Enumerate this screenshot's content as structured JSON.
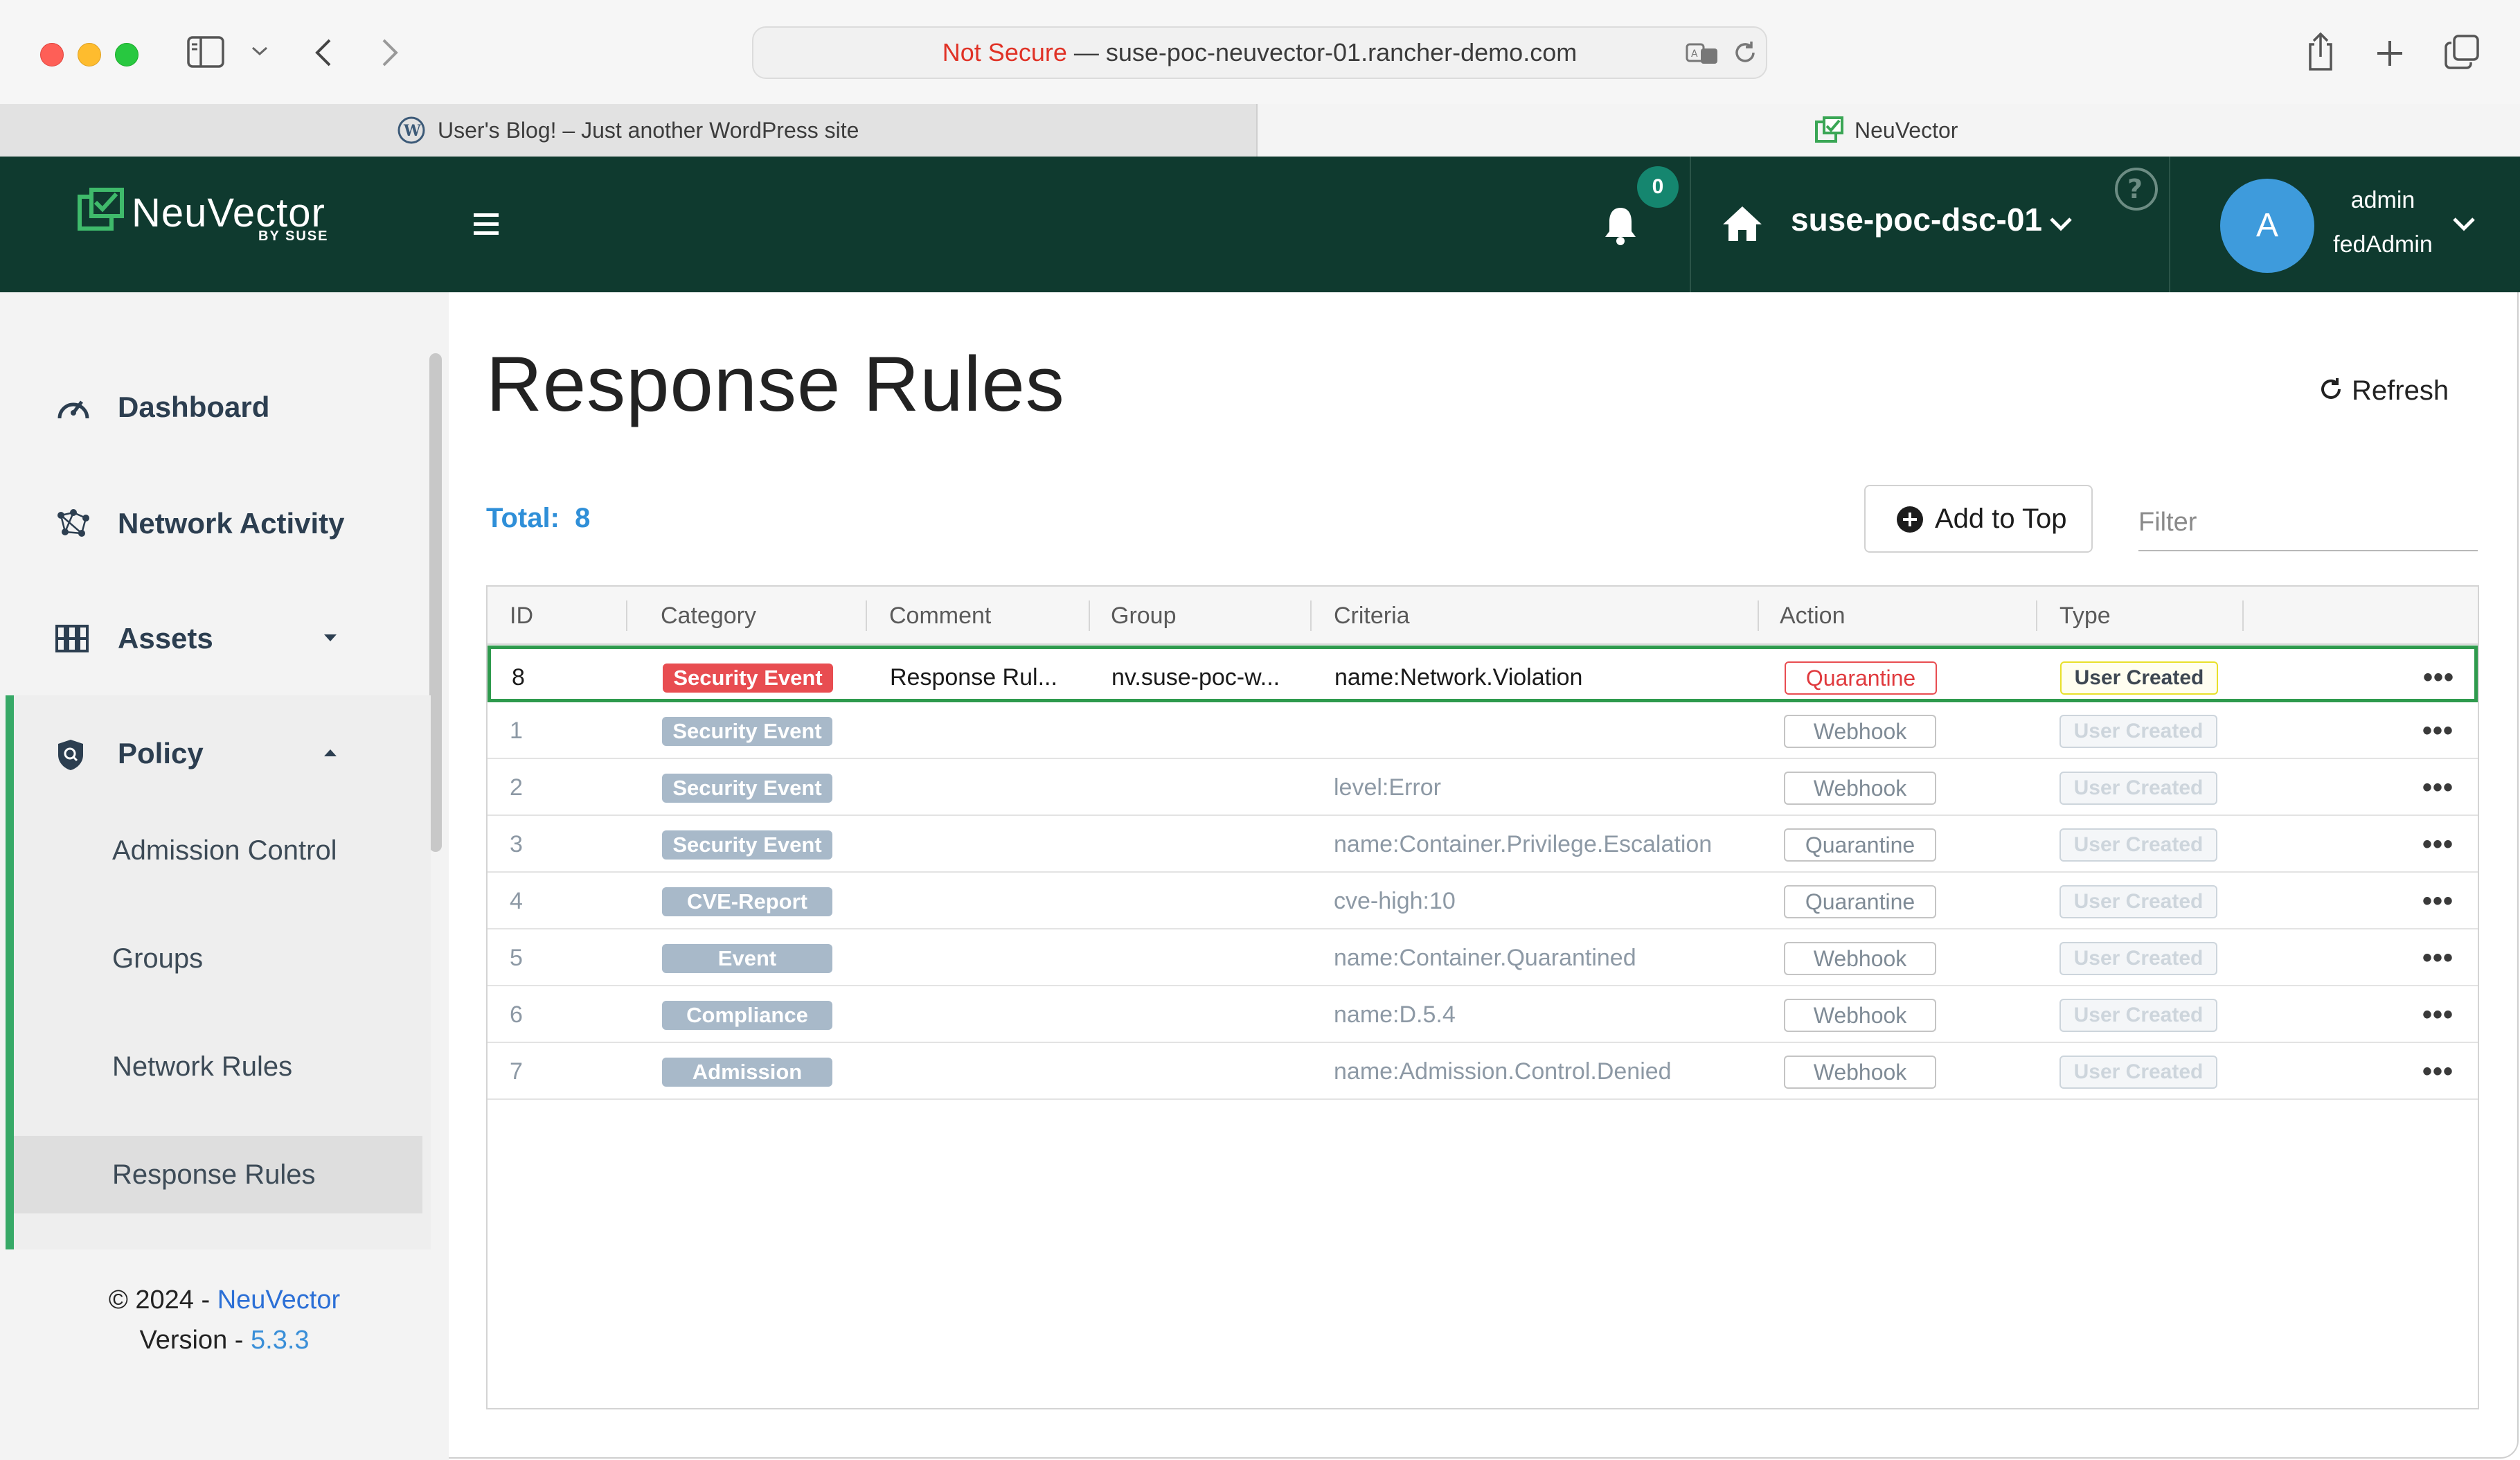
{
  "browser": {
    "url_insecure": "Not Secure",
    "url_sep": " — ",
    "url_host": "suse-poc-neuvector-01.rancher-demo.com",
    "tabs": [
      {
        "label": "User's Blog! – Just another WordPress site"
      },
      {
        "label": "NeuVector"
      }
    ]
  },
  "header": {
    "logo": "NeuVector",
    "logo_sub": "BY SUSE",
    "notifications": "0",
    "cluster": "suse-poc-dsc-01",
    "avatar_initial": "A",
    "user": "admin",
    "role": "fedAdmin"
  },
  "sidebar": {
    "items": [
      {
        "label": "Dashboard",
        "icon": "speedometer-icon"
      },
      {
        "label": "Network Activity",
        "icon": "network-icon"
      },
      {
        "label": "Assets",
        "icon": "assets-icon"
      },
      {
        "label": "Policy",
        "icon": "shield-icon"
      }
    ],
    "policy_sub": [
      {
        "label": "Admission Control"
      },
      {
        "label": "Groups"
      },
      {
        "label": "Network Rules"
      },
      {
        "label": "Response Rules"
      }
    ],
    "footer_copy": "© 2024 - ",
    "footer_brand": "NeuVector",
    "footer_version_label": "Version - ",
    "footer_version": "5.3.3"
  },
  "main": {
    "title": "Response Rules",
    "refresh": "Refresh",
    "total_label": "Total:",
    "total_value": "8",
    "add_to_top": "Add to Top",
    "filter_placeholder": "Filter",
    "columns": [
      "ID",
      "Category",
      "Comment",
      "Group",
      "Criteria",
      "Action",
      "Type"
    ],
    "rows": [
      {
        "id": "8",
        "category": "Security Event",
        "comment": "Response Rul...",
        "group": "nv.suse-poc-w...",
        "criteria": "name:Network.Violation",
        "action": "Quarantine",
        "type": "User Created"
      },
      {
        "id": "1",
        "category": "Security Event",
        "comment": "",
        "group": "",
        "criteria": "",
        "action": "Webhook",
        "type": "User Created"
      },
      {
        "id": "2",
        "category": "Security Event",
        "comment": "",
        "group": "",
        "criteria": "level:Error",
        "action": "Webhook",
        "type": "User Created"
      },
      {
        "id": "3",
        "category": "Security Event",
        "comment": "",
        "group": "",
        "criteria": "name:Container.Privilege.Escalation",
        "action": "Quarantine",
        "type": "User Created"
      },
      {
        "id": "4",
        "category": "CVE-Report",
        "comment": "",
        "group": "",
        "criteria": "cve-high:10",
        "action": "Quarantine",
        "type": "User Created"
      },
      {
        "id": "5",
        "category": "Event",
        "comment": "",
        "group": "",
        "criteria": "name:Container.Quarantined",
        "action": "Webhook",
        "type": "User Created"
      },
      {
        "id": "6",
        "category": "Compliance",
        "comment": "",
        "group": "",
        "criteria": "name:D.5.4",
        "action": "Webhook",
        "type": "User Created"
      },
      {
        "id": "7",
        "category": "Admission",
        "comment": "",
        "group": "",
        "criteria": "name:Admission.Control.Denied",
        "action": "Webhook",
        "type": "User Created"
      }
    ],
    "row_menu": "•••"
  }
}
